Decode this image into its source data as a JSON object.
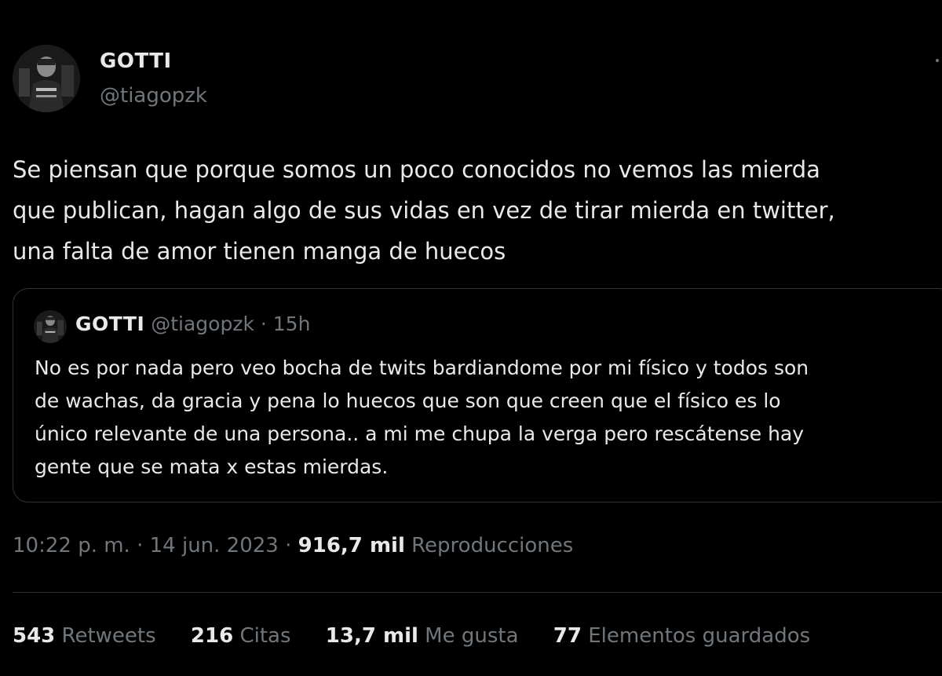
{
  "tweet": {
    "author": {
      "display_name": "GOTTI",
      "handle": "@tiagopzk"
    },
    "text_lines": [
      "Se piensan que porque somos un poco conocidos no vemos las mierda",
      "que publican, hagan algo de sus vidas en vez de tirar mierda en twitter,",
      "una falta de amor tienen manga de huecos"
    ],
    "quoted": {
      "display_name": "GOTTI",
      "handle": "@tiagopzk",
      "separator": "·",
      "time": "15h",
      "text_lines": [
        "No es por nada pero veo bocha de twits bardiandome por mi físico y todos son",
        "de wachas, da gracia y pena lo huecos que son que creen que el físico es lo",
        "único relevante de una persona.. a mi me chupa la verga pero rescátense hay",
        "gente que se mata x estas mierdas."
      ]
    },
    "meta": {
      "time": "10:22 p. m.",
      "sep1": "·",
      "date": "14 jun. 2023",
      "sep2": "·",
      "views_count": "916,7 mil",
      "views_label": "Reproducciones"
    },
    "stats": {
      "retweets_count": "543",
      "retweets_label": "Retweets",
      "quotes_count": "216",
      "quotes_label": "Citas",
      "likes_count": "13,7 mil",
      "likes_label": "Me gusta",
      "bookmarks_count": "77",
      "bookmarks_label": "Elementos guardados"
    }
  },
  "colors": {
    "background": "#000000",
    "primary_text": "#e7e9ea",
    "secondary_text": "#71767b",
    "border": "#2f3336"
  }
}
